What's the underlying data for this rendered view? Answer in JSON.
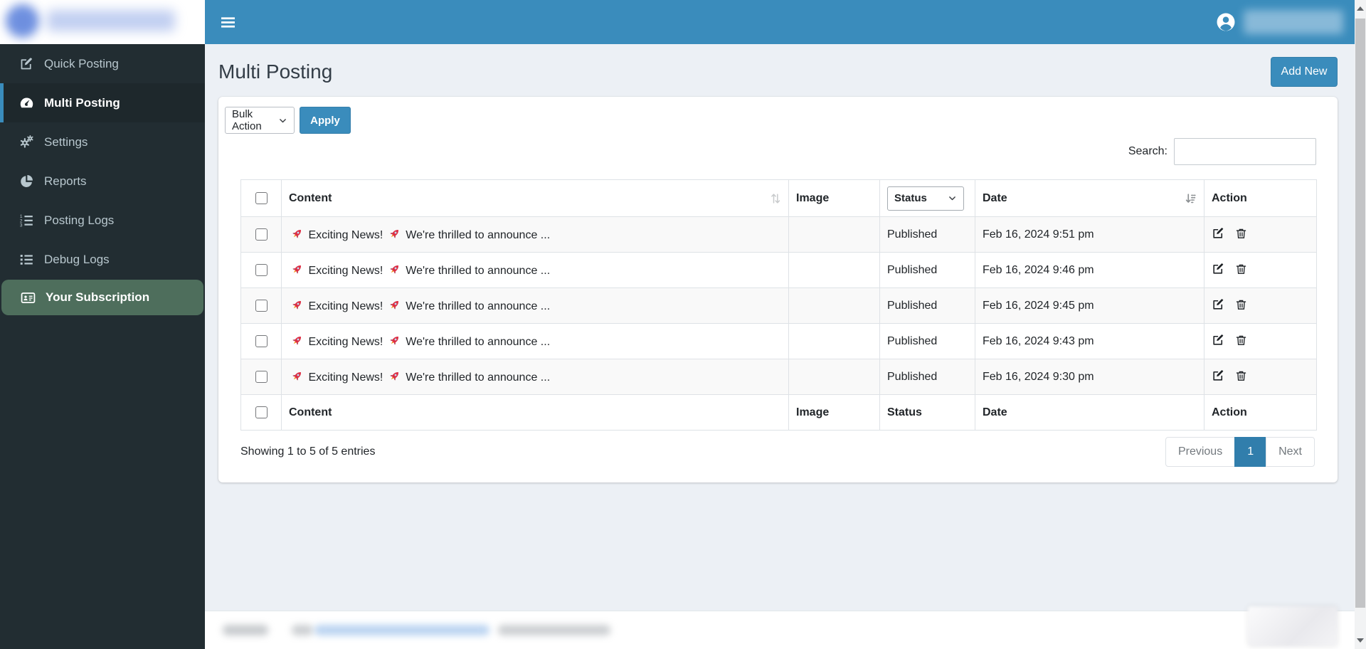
{
  "colors": {
    "topbar_blue": "#3a8cbc",
    "sidebar_dark": "#222d32",
    "active_item_dark": "#1e282c",
    "subscription_green": "#4e6e5c",
    "page_background": "#ecf0f5",
    "active_page_blue": "#317eac",
    "table_border": "#dee2e6"
  },
  "sidebar": {
    "items": [
      {
        "label": "Quick Posting",
        "icon": "edit-square-icon",
        "active": false,
        "highlight": false
      },
      {
        "label": "Multi Posting",
        "icon": "dashboard-icon",
        "active": true,
        "highlight": false
      },
      {
        "label": "Settings",
        "icon": "gears-icon",
        "active": false,
        "highlight": false
      },
      {
        "label": "Reports",
        "icon": "pie-chart-icon",
        "active": false,
        "highlight": false
      },
      {
        "label": "Posting Logs",
        "icon": "ordered-list-icon",
        "active": false,
        "highlight": false
      },
      {
        "label": "Debug Logs",
        "icon": "list-icon",
        "active": false,
        "highlight": false
      },
      {
        "label": "Your Subscription",
        "icon": "id-card-icon",
        "active": false,
        "highlight": true
      }
    ]
  },
  "header": {
    "title": "Multi Posting",
    "add_new_label": "Add New"
  },
  "toolbar": {
    "bulk_action_label": "Bulk Action",
    "apply_label": "Apply"
  },
  "search": {
    "label": "Search:",
    "value": ""
  },
  "table": {
    "columns": [
      "Content",
      "Image",
      "Status",
      "Date",
      "Action"
    ],
    "status_filter_label": "Status",
    "rows": [
      {
        "content": "🚀 Exciting News! 🚀 We're thrilled to announce ...",
        "image": "",
        "status": "Published",
        "date": "Feb 16, 2024 9:51 pm"
      },
      {
        "content": "🚀 Exciting News! 🚀 We're thrilled to announce ...",
        "image": "",
        "status": "Published",
        "date": "Feb 16, 2024 9:46 pm"
      },
      {
        "content": "🚀 Exciting News! 🚀 We're thrilled to announce ...",
        "image": "",
        "status": "Published",
        "date": "Feb 16, 2024 9:45 pm"
      },
      {
        "content": "🚀 Exciting News! 🚀 We're thrilled to announce ...",
        "image": "",
        "status": "Published",
        "date": "Feb 16, 2024 9:43 pm"
      },
      {
        "content": "🚀 Exciting News! 🚀 We're thrilled to announce ...",
        "image": "",
        "status": "Published",
        "date": "Feb 16, 2024 9:30 pm"
      }
    ],
    "footer_columns": [
      "Content",
      "Image",
      "Status",
      "Date",
      "Action"
    ],
    "summary": "Showing 1 to 5 of 5 entries",
    "pagination": {
      "previous": "Previous",
      "active_page": "1",
      "next": "Next"
    }
  }
}
